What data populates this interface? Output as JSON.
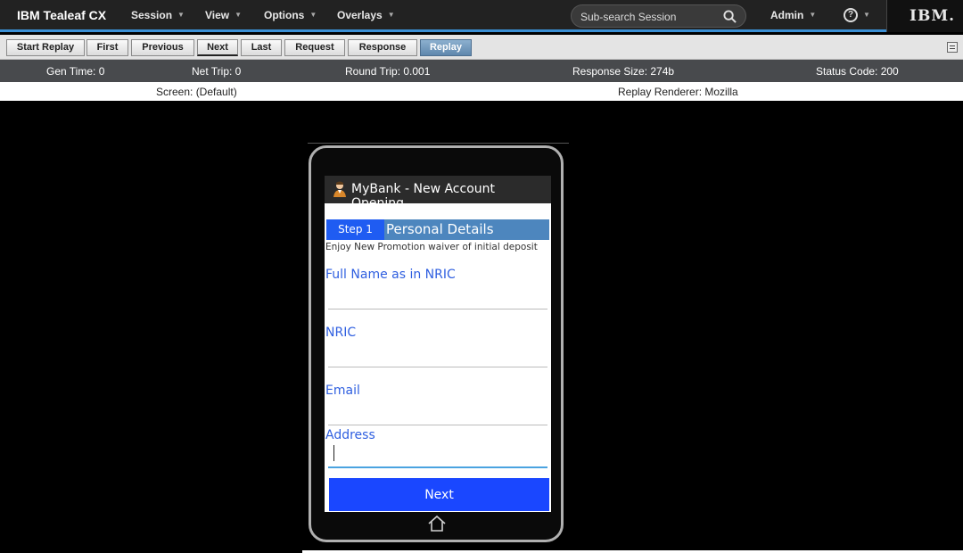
{
  "topnav": {
    "brand": "IBM Tealeaf CX",
    "menus": [
      "Session",
      "View",
      "Options",
      "Overlays"
    ],
    "search_placeholder": "Sub-search Session",
    "user": "Admin",
    "help": "?",
    "logo": "IBM."
  },
  "toolbar": {
    "buttons": [
      "Start Replay",
      "First",
      "Previous",
      "Next",
      "Last",
      "Request",
      "Response",
      "Replay"
    ],
    "active": "Replay"
  },
  "stats": {
    "gen_time": "Gen Time: 0",
    "net_trip": "Net Trip: 0",
    "round_trip": "Round Trip: 0.001",
    "response_size": "Response Size: 274b",
    "status_code": "Status Code: 200"
  },
  "screenbar": {
    "screen": "Screen: (Default)",
    "renderer": "Replay Renderer: Mozilla"
  },
  "app": {
    "title": "MyBank - New Account Opening",
    "step_badge": "Step 1",
    "step_title": "Personal Details",
    "promo": "Enjoy New Promotion waiver of initial deposit",
    "fields": [
      {
        "label": "Full Name as in NRIC",
        "value": ""
      },
      {
        "label": "NRIC",
        "value": ""
      },
      {
        "label": "Email",
        "value": ""
      },
      {
        "label": "Address",
        "value": ""
      }
    ],
    "next_label": "Next"
  },
  "colors": {
    "accent": "#3b8fd4",
    "step_bar": "#4d86be",
    "step_badge": "#1f5cf2",
    "next_button": "#1a47ff",
    "field_label": "#2f5fe0"
  }
}
